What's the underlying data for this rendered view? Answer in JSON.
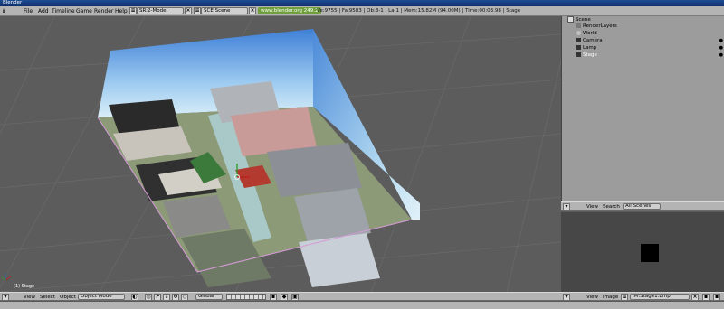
{
  "window": {
    "title": "Blender"
  },
  "menubar": {
    "menus": [
      "File",
      "Add",
      "Timeline",
      "Game",
      "Render",
      "Help"
    ],
    "screen_field": "SR:2-Model",
    "scene_field": "SCE:Scene",
    "url": "www.blender.org 249.2",
    "stats": "Ve:9755 | Fa:9583 | Ob:3-1 | La:1  | Mem:15.82M (94.00M) | Time:00:03.98 | Stage"
  },
  "viewport": {
    "corner_label": "(1) Stage"
  },
  "outliner": {
    "items": [
      {
        "label": "Scene"
      },
      {
        "label": "RenderLayers"
      },
      {
        "label": "World"
      },
      {
        "label": "Camera"
      },
      {
        "label": "Lamp"
      },
      {
        "label": "Stage"
      }
    ],
    "header": {
      "view": "View",
      "search": "Search",
      "dropdown": "All Scenes"
    }
  },
  "view3d_header": {
    "view": "View",
    "select": "Select",
    "object": "Object",
    "mode": "Object Mode",
    "orientation": "Global"
  },
  "image_header": {
    "view": "View",
    "image": "Image",
    "image_name": "IM:Stage1.bmp"
  },
  "colors": {
    "menubar": "#b4b4b4",
    "viewport": "#5c5c5c",
    "outliner": "#9c9c9c",
    "url_green": "#6fa03c"
  }
}
